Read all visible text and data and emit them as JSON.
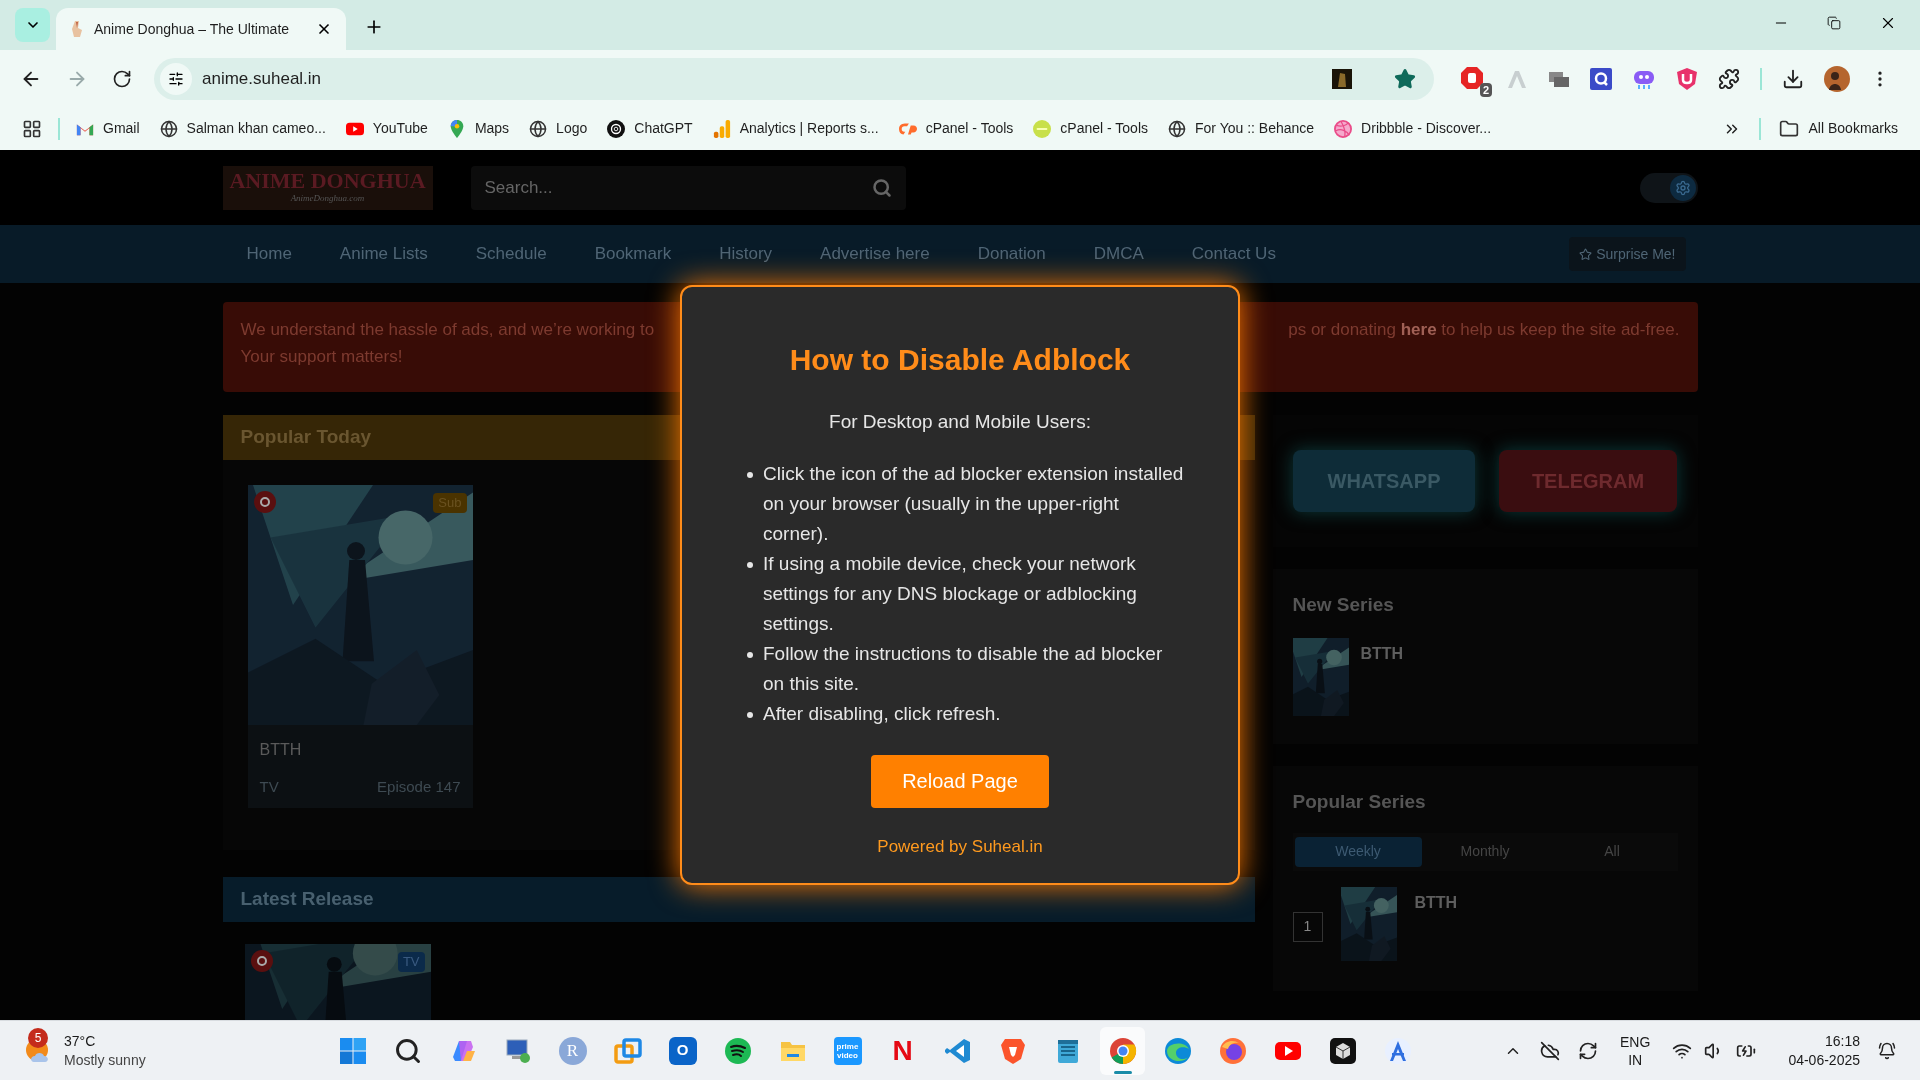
{
  "browser": {
    "tabs": [
      {
        "title": "Anime Donghua – The Ultimate",
        "selected": true
      }
    ],
    "forward_disabled": true,
    "address": "anime.suheal.in",
    "bookmarked": true,
    "extension_badge": "2",
    "bookmarks": [
      {
        "label": "Gmail",
        "kind": "mail"
      },
      {
        "label": "Salman khan cameo...",
        "kind": "globe"
      },
      {
        "label": "YouTube",
        "kind": "play"
      },
      {
        "label": "Maps",
        "kind": "pin"
      },
      {
        "label": "Logo",
        "kind": "globe"
      },
      {
        "label": "ChatGPT",
        "kind": "knot"
      },
      {
        "label": "Analytics | Reports s...",
        "kind": "bars"
      },
      {
        "label": "cPanel - Tools",
        "kind": "cp"
      },
      {
        "label": "cPanel - Tools",
        "kind": "disc"
      },
      {
        "label": "For You :: Behance",
        "kind": "globe"
      },
      {
        "label": "Dribbble - Discover...",
        "kind": "ball"
      }
    ],
    "all_bookmarks": "All Bookmarks"
  },
  "site": {
    "logo": {
      "title": "ANIME DONGHUA",
      "subtitle": "AnimeDonghua.com"
    },
    "search": {
      "placeholder": "Search..."
    },
    "dark_mode": true,
    "nav": [
      "Home",
      "Anime Lists",
      "Schedule",
      "Bookmark",
      "History",
      "Advertise here",
      "Donation",
      "DMCA",
      "Contact Us"
    ],
    "surprise": "Surprise Me!",
    "banner": {
      "left": "We understand the hassle of ads, and we’re working to",
      "right": "ps or donating **here** to help us keep the site ad-free.",
      "line2": "Your support matters!"
    },
    "popular_today": {
      "title": "Popular Today",
      "cards": [
        {
          "badge": "Sub",
          "title": "BTTH",
          "type": "TV",
          "episode": "Episode 147"
        }
      ]
    },
    "latest_release": {
      "title": "Latest Release",
      "cards": [
        {
          "badge": "TV"
        }
      ]
    },
    "social": [
      {
        "label": "WHATSAPP",
        "kind": "whatsapp"
      },
      {
        "label": "TELEGRAM",
        "kind": "telegram"
      }
    ],
    "new_series": {
      "title": "New Series",
      "items": [
        {
          "title": "BTTH"
        }
      ]
    },
    "popular_series": {
      "title": "Popular Series",
      "tabs": [
        {
          "label": "Weekly",
          "selected": true
        },
        {
          "label": "Monthly",
          "selected": false
        },
        {
          "label": "All",
          "selected": false
        }
      ],
      "items": [
        {
          "rank": "1",
          "title": "BTTH"
        }
      ]
    }
  },
  "modal": {
    "title": "How to Disable Adblock",
    "subtitle": "For Desktop and Mobile Users:",
    "steps": [
      "Click the icon of the ad blocker extension installed on your browser (usually in the upper-right corner).",
      "If using a mobile device, check your network settings for any DNS blockage or adblocking settings.",
      "Follow the instructions to disable the ad blocker on this site.",
      "After disabling, click refresh."
    ],
    "button": "Reload Page",
    "footer": "Powered by Suheal.in"
  },
  "taskbar": {
    "weather": {
      "badge": "5",
      "temp": "37°C",
      "condition": "Mostly sunny"
    },
    "apps": [
      {
        "kind": "windows",
        "selected": false
      },
      {
        "kind": "search",
        "selected": false
      },
      {
        "kind": "copilot",
        "selected": false
      },
      {
        "kind": "remote",
        "selected": false
      },
      {
        "kind": "letter",
        "label": "R",
        "selected": false
      },
      {
        "kind": "vm",
        "selected": false
      },
      {
        "kind": "outlook",
        "label": "O",
        "selected": false
      },
      {
        "kind": "spotify",
        "selected": false
      },
      {
        "kind": "folder",
        "selected": false
      },
      {
        "kind": "prime",
        "label": "prime video",
        "selected": false
      },
      {
        "kind": "netflix",
        "label": "N",
        "selected": false
      },
      {
        "kind": "code",
        "selected": false
      },
      {
        "kind": "lion",
        "selected": false
      },
      {
        "kind": "notepad",
        "selected": false
      },
      {
        "kind": "chrome",
        "selected": true
      },
      {
        "kind": "edge",
        "selected": false
      },
      {
        "kind": "firefox",
        "selected": false
      },
      {
        "kind": "youtube",
        "selected": false
      },
      {
        "kind": "cube",
        "selected": false
      },
      {
        "kind": "compass",
        "selected": false
      }
    ],
    "language": "ENG",
    "region": "IN",
    "time": "16:18",
    "date": "04-06-2025"
  }
}
